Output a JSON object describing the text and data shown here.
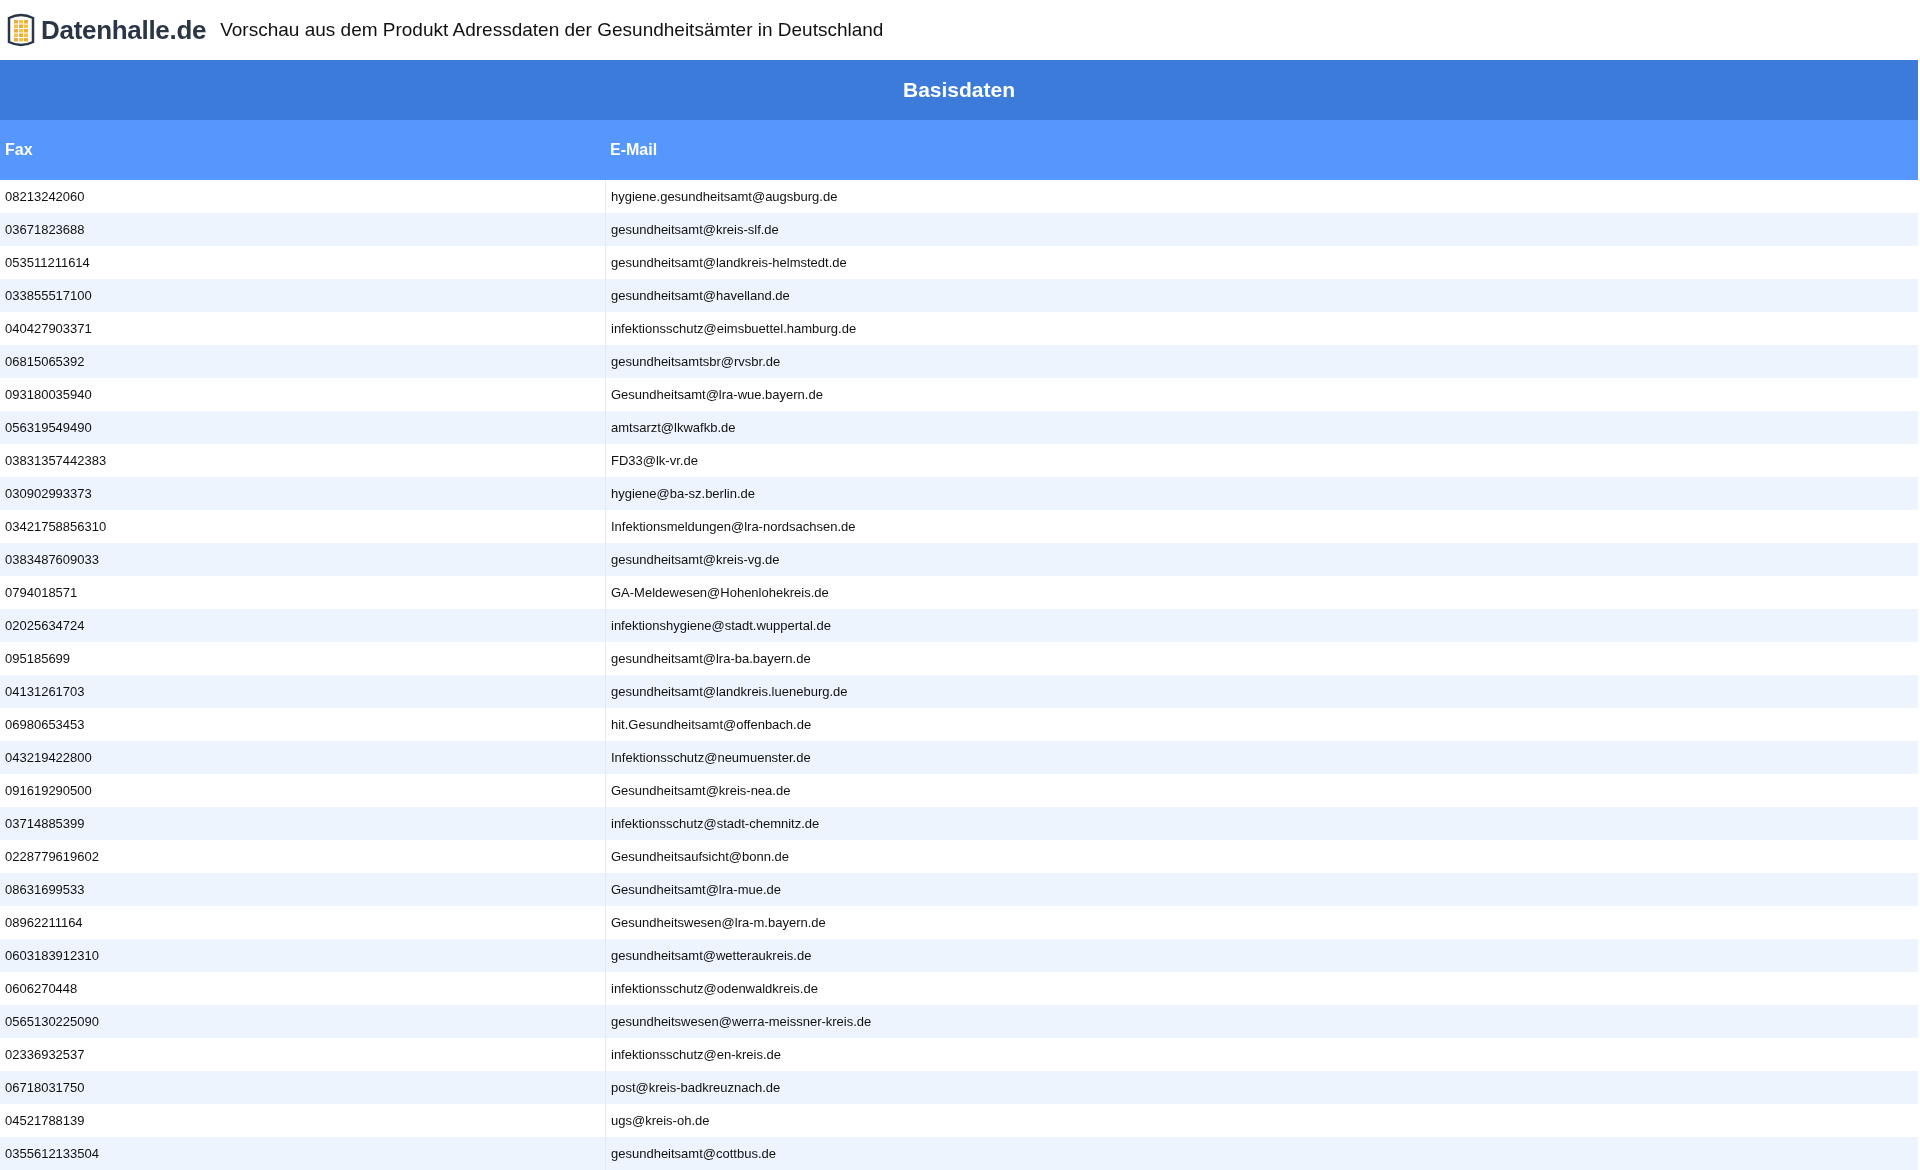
{
  "header": {
    "logo_text": "Datenhalle.de",
    "title": "Vorschau aus dem Produkt Adressdaten der Gesundheitsämter in Deutschland"
  },
  "table": {
    "group_title": "Basisdaten",
    "columns": [
      "Fax",
      "E-Mail"
    ],
    "rows": [
      [
        "08213242060",
        "hygiene.gesundheitsamt@augsburg.de"
      ],
      [
        "03671823688",
        "gesundheitsamt@kreis-slf.de"
      ],
      [
        "053511211614",
        "gesundheitsamt@landkreis-helmstedt.de"
      ],
      [
        "033855517100",
        "gesundheitsamt@havelland.de"
      ],
      [
        "040427903371",
        "infektionsschutz@eimsbuettel.hamburg.de"
      ],
      [
        "06815065392",
        "gesundheitsamtsbr@rvsbr.de"
      ],
      [
        "093180035940",
        "Gesundheitsamt@lra-wue.bayern.de"
      ],
      [
        "056319549490",
        "amtsarzt@lkwafkb.de"
      ],
      [
        "03831357442383",
        "FD33@lk-vr.de"
      ],
      [
        "030902993373",
        "hygiene@ba-sz.berlin.de"
      ],
      [
        "03421758856310",
        "Infektionsmeldungen@lra-nordsachsen.de"
      ],
      [
        "0383487609033",
        "gesundheitsamt@kreis-vg.de"
      ],
      [
        "0794018571",
        "GA-Meldewesen@Hohenlohekreis.de"
      ],
      [
        "02025634724",
        "infektionshygiene@stadt.wuppertal.de"
      ],
      [
        "095185699",
        "gesundheitsamt@lra-ba.bayern.de"
      ],
      [
        "04131261703",
        "gesundheitsamt@landkreis.lueneburg.de"
      ],
      [
        "06980653453",
        "hit.Gesundheitsamt@offenbach.de"
      ],
      [
        "043219422800",
        "Infektionsschutz@neumuenster.de"
      ],
      [
        "091619290500",
        "Gesundheitsamt@kreis-nea.de"
      ],
      [
        "03714885399",
        "infektionsschutz@stadt-chemnitz.de"
      ],
      [
        "0228779619602",
        "Gesundheitsaufsicht@bonn.de"
      ],
      [
        "08631699533",
        "Gesundheitsamt@lra-mue.de"
      ],
      [
        "08962211164",
        "Gesundheitswesen@lra-m.bayern.de"
      ],
      [
        "0603183912310",
        "gesundheitsamt@wetteraukreis.de"
      ],
      [
        "0606270448",
        "infektionsschutz@odenwaldkreis.de"
      ],
      [
        "0565130225090",
        "gesundheitswesen@werra-meissner-kreis.de"
      ],
      [
        "02336932537",
        "infektionsschutz@en-kreis.de"
      ],
      [
        "06718031750",
        "post@kreis-badkreuznach.de"
      ],
      [
        "04521788139",
        "ugs@kreis-oh.de"
      ],
      [
        "0355612133504",
        "gesundheitsamt@cottbus.de"
      ]
    ]
  }
}
